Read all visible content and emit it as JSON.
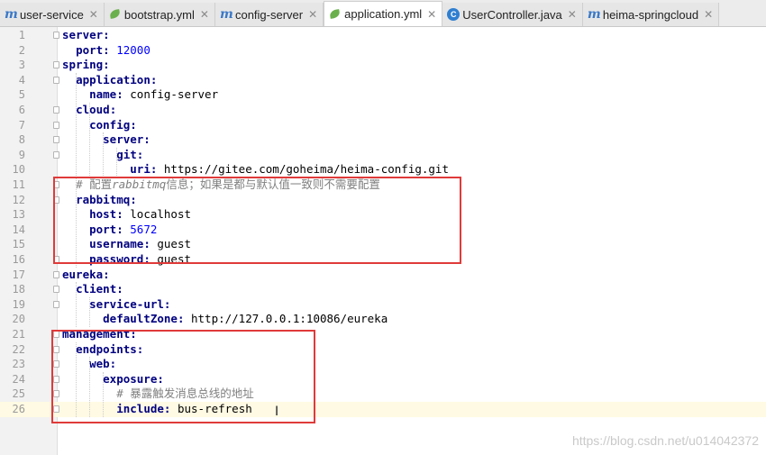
{
  "tabs": [
    {
      "icon": "m-icon",
      "glyph": "m",
      "label": "user-service",
      "active": false
    },
    {
      "icon": "spring-leaf-icon",
      "glyph": "",
      "label": "bootstrap.yml",
      "active": false
    },
    {
      "icon": "m-icon",
      "glyph": "m",
      "label": "config-server",
      "active": false
    },
    {
      "icon": "spring-leaf-icon",
      "glyph": "",
      "label": "application.yml",
      "active": true
    },
    {
      "icon": "class-icon",
      "glyph": "C",
      "label": "UserController.java",
      "active": false
    },
    {
      "icon": "m-icon",
      "glyph": "m",
      "label": "heima-springcloud",
      "active": false
    }
  ],
  "close_glyph": "✕",
  "lines": [
    [
      {
        "t": "server:",
        "c": "key"
      }
    ],
    [
      {
        "t": "  "
      },
      {
        "t": "port:",
        "c": "key"
      },
      {
        "t": " "
      },
      {
        "t": "12000",
        "c": "num"
      }
    ],
    [
      {
        "t": "spring:",
        "c": "key"
      }
    ],
    [
      {
        "t": "  "
      },
      {
        "t": "application:",
        "c": "key"
      }
    ],
    [
      {
        "t": "    "
      },
      {
        "t": "name:",
        "c": "key"
      },
      {
        "t": " config-server"
      }
    ],
    [
      {
        "t": "  "
      },
      {
        "t": "cloud:",
        "c": "key"
      }
    ],
    [
      {
        "t": "    "
      },
      {
        "t": "config:",
        "c": "key"
      }
    ],
    [
      {
        "t": "      "
      },
      {
        "t": "server:",
        "c": "key"
      }
    ],
    [
      {
        "t": "        "
      },
      {
        "t": "git:",
        "c": "key"
      }
    ],
    [
      {
        "t": "          "
      },
      {
        "t": "uri:",
        "c": "key"
      },
      {
        "t": " https://gitee.com/goheima/heima-config.git"
      }
    ],
    [
      {
        "t": "  "
      },
      {
        "t": "# 配置",
        "c": "cmt"
      },
      {
        "t": "rabbitmq",
        "c": "cmt cmt-it"
      },
      {
        "t": "信息；如果是都与默认值一致则不需要配置",
        "c": "cmt"
      }
    ],
    [
      {
        "t": "  "
      },
      {
        "t": "rabbitmq:",
        "c": "key"
      }
    ],
    [
      {
        "t": "    "
      },
      {
        "t": "host:",
        "c": "key"
      },
      {
        "t": " localhost"
      }
    ],
    [
      {
        "t": "    "
      },
      {
        "t": "port:",
        "c": "key"
      },
      {
        "t": " "
      },
      {
        "t": "5672",
        "c": "num"
      }
    ],
    [
      {
        "t": "    "
      },
      {
        "t": "username:",
        "c": "key"
      },
      {
        "t": " guest"
      }
    ],
    [
      {
        "t": "    "
      },
      {
        "t": "password:",
        "c": "key"
      },
      {
        "t": " guest"
      }
    ],
    [
      {
        "t": "eureka:",
        "c": "key"
      }
    ],
    [
      {
        "t": "  "
      },
      {
        "t": "client:",
        "c": "key"
      }
    ],
    [
      {
        "t": "    "
      },
      {
        "t": "service-url:",
        "c": "key"
      }
    ],
    [
      {
        "t": "      "
      },
      {
        "t": "defaultZone:",
        "c": "key"
      },
      {
        "t": " http://127.0.0.1:10086/eureka"
      }
    ],
    [
      {
        "t": "management:",
        "c": "key"
      }
    ],
    [
      {
        "t": "  "
      },
      {
        "t": "endpoints:",
        "c": "key"
      }
    ],
    [
      {
        "t": "    "
      },
      {
        "t": "web:",
        "c": "key"
      }
    ],
    [
      {
        "t": "      "
      },
      {
        "t": "exposure:",
        "c": "key"
      }
    ],
    [
      {
        "t": "        "
      },
      {
        "t": "# 暴露触发消息总线的地址",
        "c": "cmt"
      }
    ],
    [
      {
        "t": "        "
      },
      {
        "t": "include:",
        "c": "key"
      },
      {
        "t": " bus-refresh"
      }
    ]
  ],
  "current_line": 26,
  "highlight_color": "#e03a3a",
  "cursor_glyph": "I",
  "watermark": "https://blog.csdn.net/u014042372"
}
